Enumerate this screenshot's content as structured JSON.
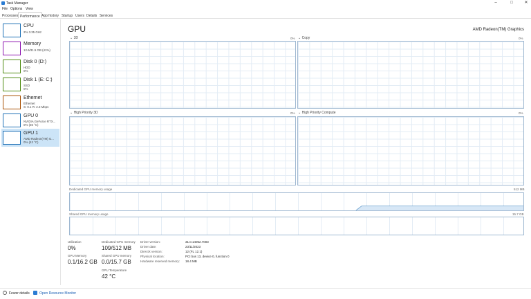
{
  "window": {
    "title": "Task Manager",
    "controls": [
      "–",
      "□",
      "✕"
    ]
  },
  "menu": [
    "File",
    "Options",
    "View"
  ],
  "tabs": [
    "Processes",
    "Performance",
    "App history",
    "Startup",
    "Users",
    "Details",
    "Services"
  ],
  "active_tab": "Performance",
  "sidebar": [
    {
      "name": "CPU",
      "lines": [
        "2% 3.35 GHz"
      ]
    },
    {
      "name": "Memory",
      "lines": [
        "12.6/31.5 GB (41%)"
      ]
    },
    {
      "name": "Disk 0 (D:)",
      "lines": [
        "HDD",
        "0%"
      ]
    },
    {
      "name": "Disk 1 (E: C:)",
      "lines": [
        "SSD",
        "0%"
      ]
    },
    {
      "name": "Ethernet",
      "lines": [
        "Ethernet",
        "S: 0.1 R: 2.3 Mbps"
      ]
    },
    {
      "name": "GPU 0",
      "lines": [
        "NVIDIA GeForce RTX...",
        "0% (36 °C)"
      ]
    },
    {
      "name": "GPU 1",
      "lines": [
        "AMD Radeon(TM) G...",
        "0% (42 °C)"
      ]
    }
  ],
  "main": {
    "title": "GPU",
    "device_name": "AMD Radeon(TM) Graphics",
    "engines": [
      {
        "label": "3D",
        "percent": "0%"
      },
      {
        "label": "Copy",
        "percent": "0%"
      },
      {
        "label": "High Priority 3D",
        "percent": "0%"
      },
      {
        "label": "High Priority Compute",
        "percent": "0%"
      }
    ],
    "dedicated_memory_label": "Dedicated GPU memory usage",
    "dedicated_memory_max": "512 MB",
    "shared_memory_label": "Shared GPU memory usage",
    "shared_memory_max": "15.7 GB"
  },
  "stats": {
    "utilization_label": "Utilization",
    "utilization": "0%",
    "dedicated_label": "Dedicated GPU memory",
    "dedicated": "109/512 MB",
    "gpu_memory_label": "GPU Memory",
    "gpu_memory": "0.1/16.2 GB",
    "shared_label": "Shared GPU memory",
    "shared": "0.0/15.7 GB",
    "temp_label": "GPU Temperature",
    "temp": "42 °C"
  },
  "info": [
    {
      "key": "Driver version:",
      "value": "31.0.14052.7003"
    },
    {
      "key": "Driver date:",
      "value": "23/11/2023"
    },
    {
      "key": "DirectX version:",
      "value": "12 (FL 12.1)"
    },
    {
      "key": "Physical location:",
      "value": "PCI bus 13, device 0, function 0"
    },
    {
      "key": "Hardware reserved memory:",
      "value": "18.4 MB"
    }
  ],
  "footer": {
    "fewer_details": "Fewer details",
    "resource_monitor": "Open Resource Monitor"
  }
}
